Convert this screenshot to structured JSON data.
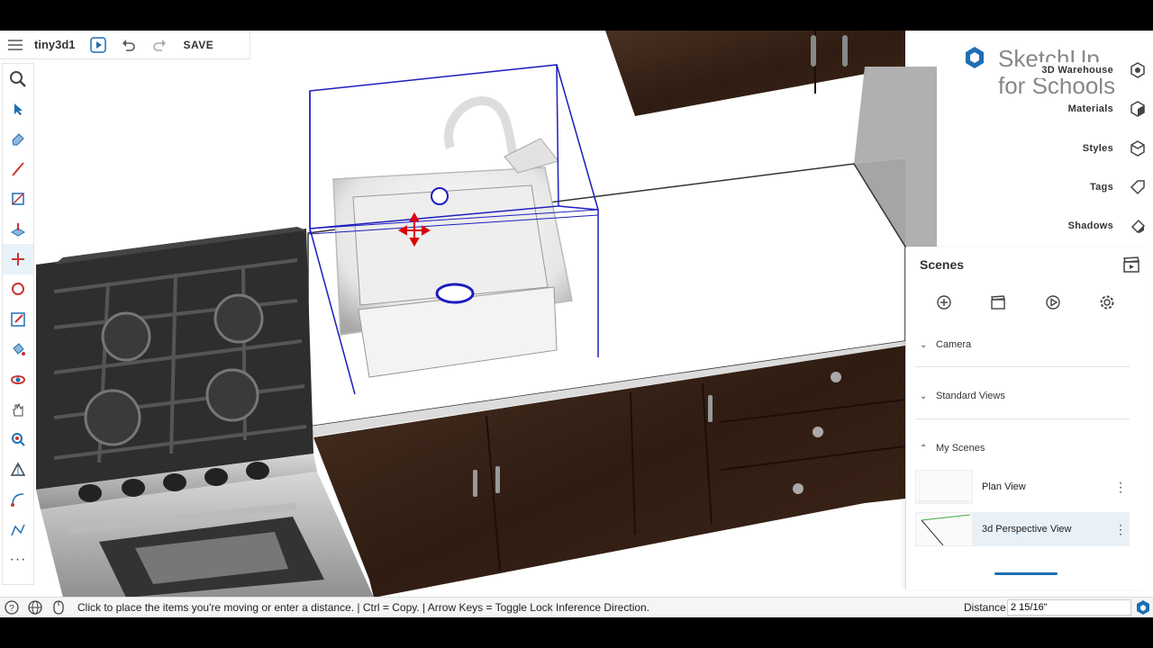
{
  "topbar": {
    "doc_title": "tiny3d1",
    "save_label": "SAVE"
  },
  "logo": {
    "line1": "SketchUp",
    "line2": "for Schools"
  },
  "right_tabs": [
    {
      "label": "3D Warehouse",
      "icon": "warehouse-icon"
    },
    {
      "label": "Materials",
      "icon": "materials-cube-icon"
    },
    {
      "label": "Styles",
      "icon": "styles-cube-icon"
    },
    {
      "label": "Tags",
      "icon": "tag-icon"
    },
    {
      "label": "Shadows",
      "icon": "shadow-eraser-icon"
    }
  ],
  "scenes_panel": {
    "title": "Scenes",
    "sections": {
      "camera": "Camera",
      "standard_views": "Standard Views",
      "my_scenes": "My Scenes"
    },
    "scenes": [
      {
        "name": "Plan View"
      },
      {
        "name": "3d Perspective View",
        "selected": true
      }
    ]
  },
  "status": {
    "message": "Click to place the items you're moving or enter a distance. | Ctrl = Copy. | Arrow Keys = Toggle Lock Inference Direction.",
    "distance_label": "Distance",
    "distance_value": "2 15/16\""
  },
  "colors": {
    "accent": "#1e6fb4",
    "cabinet": "#3b261b",
    "selection": "#1d1dbf"
  }
}
